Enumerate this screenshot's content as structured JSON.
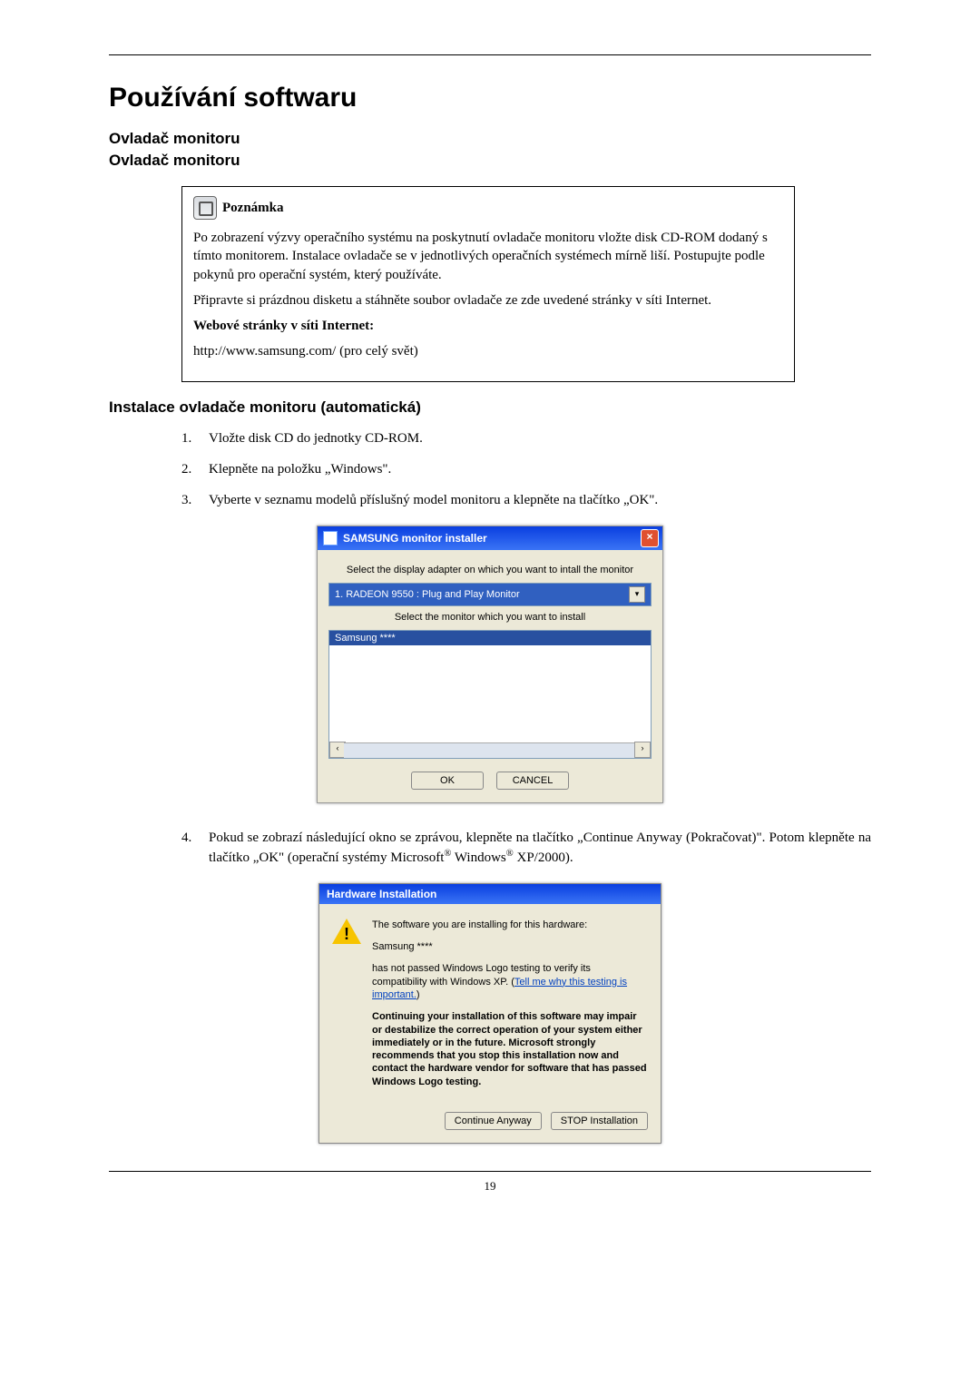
{
  "page_number": "19",
  "h1": "Používání softwaru",
  "h2a": "Ovladač monitoru",
  "h2b": "Ovladač monitoru",
  "note": {
    "label": "Poznámka",
    "para1": "Po zobrazení výzvy operačního systému na poskytnutí ovladače monitoru vložte disk CD-ROM dodaný s tímto monitorem. Instalace ovladače se v jednotlivých operačních systémech mírně liší. Postupujte podle pokynů pro operační systém, který používáte.",
    "para2": "Připravte si prázdnou disketu a stáhněte soubor ovladače ze zde uvedené stránky v síti Internet.",
    "web_label": "Webové stránky v síti Internet:",
    "url": "http://www.samsung.com/ (pro celý svět)"
  },
  "h3": "Instalace ovladače monitoru (automatická)",
  "steps": {
    "s1n": "1.",
    "s1t": "Vložte disk CD do jednotky CD-ROM.",
    "s2n": "2.",
    "s2t": "Klepněte na položku „Windows\".",
    "s3n": "3.",
    "s3t": "Vyberte v seznamu modelů příslušný model monitoru a klepněte na tlačítko „OK\".",
    "s4n": "4.",
    "s4t_a": "Pokud se zobrazí následující okno se zprávou, klepněte na tlačítko „Continue Anyway (Pokračovat)\". Potom klepněte na tlačítko „OK\" (operační systémy Microsoft",
    "s4t_b": " Windows",
    "s4t_c": " XP/2000)."
  },
  "installer": {
    "title": "SAMSUNG monitor installer",
    "close": "×",
    "label1": "Select the display adapter on which you want to intall the monitor",
    "adapter": "1. RADEON 9550 : Plug and Play Monitor",
    "dd_glyph": "▾",
    "label2": "Select the monitor which you want to install",
    "selected": "Samsung ****",
    "scroll_l": "‹",
    "scroll_r": "›",
    "ok": "OK",
    "cancel": "CANCEL"
  },
  "hw": {
    "title": "Hardware Installation",
    "bang": "!",
    "l1": "The software you are installing for this hardware:",
    "l2": "Samsung ****",
    "l3a": "has not passed Windows Logo testing to verify its compatibility with Windows XP. (",
    "link": "Tell me why this testing is important.",
    "l3b": ")",
    "bold": "Continuing your installation of this software may impair or destabilize the correct operation of your system either immediately or in the future. Microsoft strongly recommends that you stop this installation now and contact the hardware vendor for software that has passed Windows Logo testing.",
    "btn_continue": "Continue Anyway",
    "btn_stop": "STOP Installation"
  }
}
